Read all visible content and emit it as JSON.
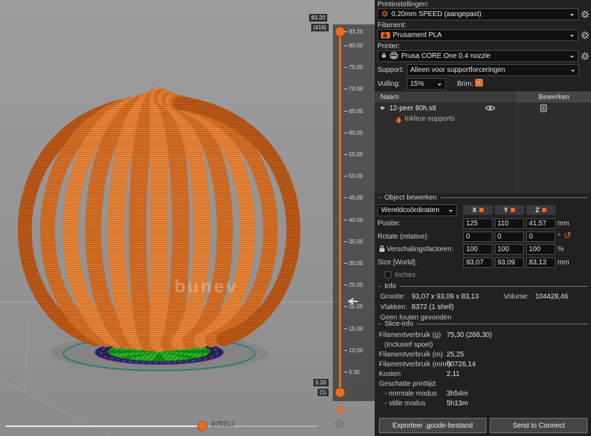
{
  "viewport": {
    "bed_text": "bunev",
    "bottom_slider": {
      "value": "875317"
    }
  },
  "layer_slider": {
    "max": 83.2,
    "min": 0.2,
    "top_tooltip": {
      "height": "83.20",
      "layer": "(416)"
    },
    "bottom_tooltip": {
      "height": "0.20",
      "layer": "(1)"
    },
    "ticks": [
      {
        "label": "83.20",
        "value": 83.2
      },
      {
        "label": "80.00",
        "value": 80
      },
      {
        "label": "75.00",
        "value": 75
      },
      {
        "label": "70.00",
        "value": 70
      },
      {
        "label": "65.00",
        "value": 65
      },
      {
        "label": "60.00",
        "value": 60
      },
      {
        "label": "55.00",
        "value": 55
      },
      {
        "label": "50.00",
        "value": 50
      },
      {
        "label": "45.00",
        "value": 45
      },
      {
        "label": "40.00",
        "value": 40
      },
      {
        "label": "35.00",
        "value": 35
      },
      {
        "label": "30.00",
        "value": 30
      },
      {
        "label": "25.00",
        "value": 25
      },
      {
        "label": "20.00",
        "value": 20
      },
      {
        "label": "15.00",
        "value": 15
      },
      {
        "label": "10.00",
        "value": 10
      },
      {
        "label": "5.00",
        "value": 5
      }
    ]
  },
  "sidebar": {
    "print_settings": {
      "label": "Printinstellingen:",
      "value": "0.20mm SPEED (aangepast)"
    },
    "filament": {
      "label": "Filament:",
      "value": "Prusament PLA"
    },
    "printer": {
      "label": "Printer:",
      "value": "Prusa CORE One 0.4 nozzle"
    },
    "support": {
      "label": "Support:",
      "value": "Alleen voor supportforceringen"
    },
    "infill": {
      "label": "Vulling:",
      "value": "15%"
    },
    "brim": {
      "label": "Brim:",
      "checked": true
    },
    "object_table": {
      "col_name": "Naam",
      "col_edit": "Bewerken",
      "object_name": "12-peer 80h.stl",
      "sub_item": "Inkleur-supports"
    },
    "manipulation": {
      "title": "Object bewerken",
      "coord_system": "Wereldcoördinaten",
      "axes": [
        "X",
        "Y",
        "Z"
      ],
      "rows": [
        {
          "label": "Positie:",
          "values": [
            "125",
            "110",
            "41,57"
          ],
          "unit": "mm"
        },
        {
          "label": "Rotate (relative):",
          "values": [
            "0",
            "0",
            "0"
          ],
          "unit": "°"
        },
        {
          "label": "Verschalingsfactoren:",
          "values": [
            "100",
            "100",
            "100"
          ],
          "unit": "%"
        },
        {
          "label": "Size [World]:",
          "values": [
            "93,07",
            "93,09",
            "83,13"
          ],
          "unit": "mm"
        }
      ],
      "inches_label": "Inches"
    },
    "info": {
      "title": "Info",
      "size_label": "Grootte:",
      "size_value": "93,07 x 93,09 x 83,13",
      "volume_label": "Volume:",
      "volume_value": "104428,46",
      "facets_label": "Vlakken:",
      "facets_value": "8372 (1 shell)",
      "status": "Geen fouten gevonden"
    },
    "slice_info": {
      "title": "Slice-info",
      "rows": [
        {
          "label": "Filamentverbruik (g)",
          "value": "75,30 (268,30)"
        },
        {
          "label": "(inclusief spoel)",
          "value": "",
          "indent": true
        },
        {
          "label": "Filamentverbruik (m)",
          "value": "25,25"
        },
        {
          "label": "Filamentverbruik (mm³)",
          "value": "60726,14"
        },
        {
          "label": "Kosten",
          "value": "2,11"
        },
        {
          "label": "Geschatte printtijd:",
          "value": ""
        },
        {
          "label": "- normale modus",
          "value": "3h54m",
          "indent": true
        },
        {
          "label": "- stille modus",
          "value": "5h13m",
          "indent": true
        }
      ]
    },
    "buttons": {
      "export": "Exporteer .gcode-bestand",
      "send": "Send to Connect"
    }
  },
  "icons": {
    "check": "✓",
    "reset": "↺"
  },
  "colors": {
    "accent": "#ED6B21"
  }
}
